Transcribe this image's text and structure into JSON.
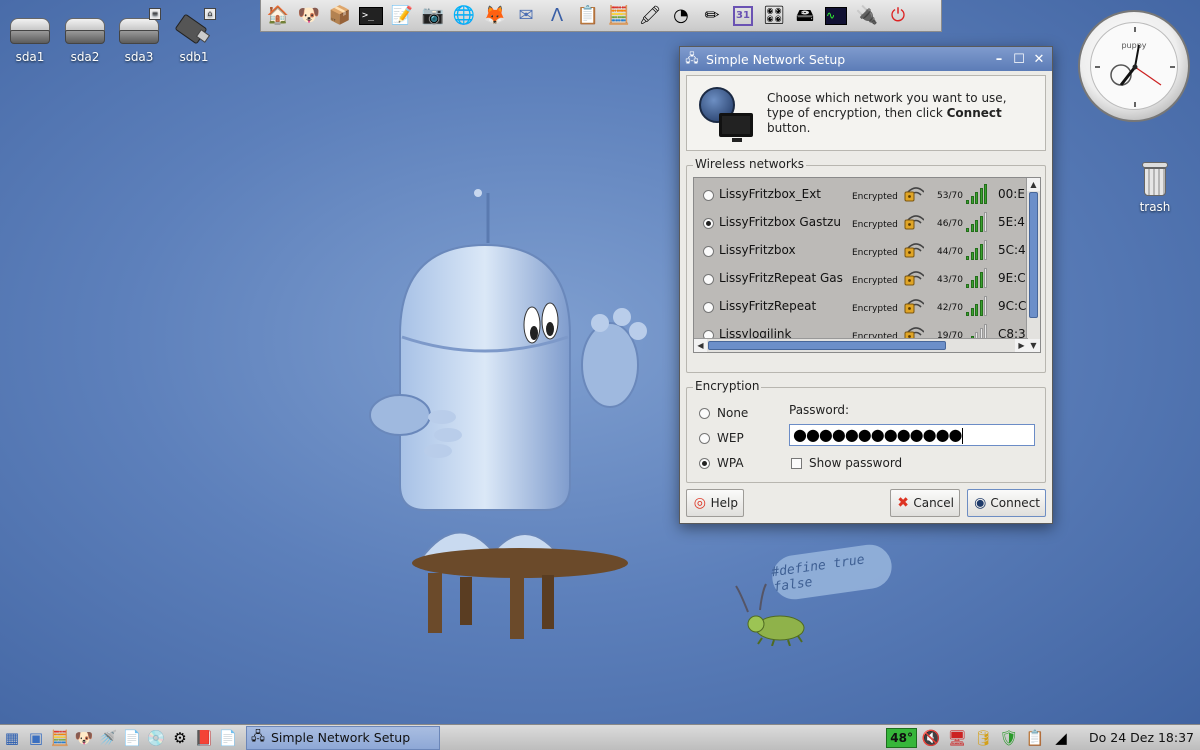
{
  "desktop": {
    "drives": [
      {
        "label": "sda1"
      },
      {
        "label": "sda2"
      },
      {
        "label": "sda3"
      },
      {
        "label": "sdb1"
      }
    ],
    "trash_label": "trash",
    "clock_brand": "puppy",
    "bubble_text": "#define true false"
  },
  "launcher": {
    "icons": [
      "home-folder-icon",
      "puppy-dog-icon",
      "package-manager-icon",
      "terminal-icon",
      "text-editor-icon",
      "camera-icon",
      "globe-browser-icon",
      "firefox-icon",
      "mail-icon",
      "draw-icon",
      "notes-icon",
      "calculator-icon",
      "crayons-icon",
      "chart-pie-icon",
      "pencil-icon",
      "calendar-icon",
      "audio-mixer-icon",
      "drive-icon",
      "system-monitor-icon",
      "network-icon",
      "power-icon"
    ]
  },
  "window": {
    "title": "Simple Network Setup",
    "intro_text": "Choose which network you want to use, type of encryption, then click ",
    "intro_bold": "Connect",
    "intro_tail": " button.",
    "wireless_group_label": "Wireless networks",
    "networks": [
      {
        "ssid": "LissyFritzbox_Ext",
        "encryption": "Encrypted",
        "quality": "53/70",
        "signal_bars": 5,
        "mac": "00:E",
        "selected": false
      },
      {
        "ssid": "LissyFritzbox Gastzu",
        "encryption": "Encrypted",
        "quality": "46/70",
        "signal_bars": 4,
        "mac": "5E:4",
        "selected": true
      },
      {
        "ssid": "LissyFritzbox",
        "encryption": "Encrypted",
        "quality": "44/70",
        "signal_bars": 4,
        "mac": "5C:4",
        "selected": false
      },
      {
        "ssid": "LissyFritzRepeat Gas",
        "encryption": "Encrypted",
        "quality": "43/70",
        "signal_bars": 4,
        "mac": "9E:C",
        "selected": false
      },
      {
        "ssid": "LissyFritzRepeat",
        "encryption": "Encrypted",
        "quality": "42/70",
        "signal_bars": 4,
        "mac": "9C:C",
        "selected": false
      },
      {
        "ssid": "Lissylogilink",
        "encryption": "Encrypted",
        "quality": "19/70",
        "signal_bars": 2,
        "mac": "C8:3",
        "selected": false
      }
    ],
    "encryption_group_label": "Encryption",
    "encryption_options": [
      {
        "label": "None",
        "selected": false
      },
      {
        "label": "WEP",
        "selected": false
      },
      {
        "label": "WPA",
        "selected": true
      }
    ],
    "password_label": "Password:",
    "password_value": "●●●●●●●●●●●●●",
    "show_password_label": "Show password",
    "show_password_checked": false,
    "buttons": {
      "help": "Help",
      "cancel": "Cancel",
      "connect": "Connect"
    }
  },
  "taskbar": {
    "task_label": "Simple Network Setup",
    "temperature": "48°",
    "datetime": "Do 24 Dez 18:37"
  }
}
